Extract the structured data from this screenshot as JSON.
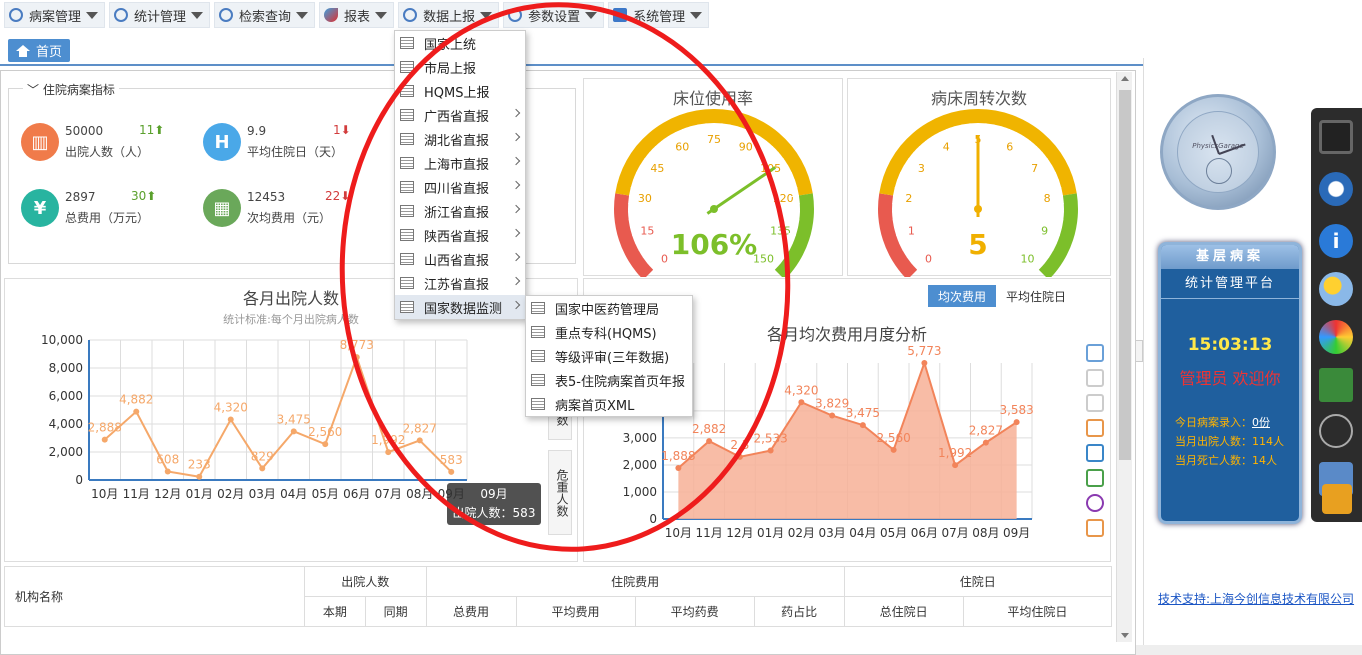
{
  "menu": [
    {
      "label": "病案管理",
      "icon": "record-icon"
    },
    {
      "label": "统计管理",
      "icon": "stats-icon"
    },
    {
      "label": "检索查询",
      "icon": "search-icon"
    },
    {
      "label": "报表",
      "icon": "report-icon"
    },
    {
      "label": "数据上报",
      "icon": "upload-icon"
    },
    {
      "label": "参数设置",
      "icon": "settings-icon"
    },
    {
      "label": "系统管理",
      "icon": "system-icon"
    }
  ],
  "tabs": {
    "home": "首页"
  },
  "indicators": {
    "legend": "住院病案指标",
    "items": [
      {
        "value": "50000",
        "label": "出院人数（人）",
        "delta": "11",
        "dir": "up",
        "color": "#f07b4a",
        "glyph": "▥"
      },
      {
        "value": "9.9",
        "label": "平均住院日（天）",
        "delta": "1",
        "dir": "down",
        "color": "#4aa8e8",
        "glyph": "H"
      },
      {
        "value": "2897",
        "label": "总费用（万元）",
        "delta": "30",
        "dir": "up",
        "color": "#28b4a0",
        "glyph": "¥"
      },
      {
        "value": "12453",
        "label": "次均费用（元）",
        "delta": "22",
        "dir": "down",
        "color": "#6aa85a",
        "glyph": "▦"
      }
    ]
  },
  "gauges": [
    {
      "title": "床位使用率",
      "value": "106%",
      "value_color": "#7cbf2a",
      "ticks": [
        "0",
        "15",
        "30",
        "45",
        "60",
        "75",
        "90",
        "105",
        "120",
        "135",
        "150"
      ],
      "min": 0,
      "max": 150,
      "reading": 106,
      "needle_color": "#7cbf2a"
    },
    {
      "title": "病床周转次数",
      "value": "5",
      "value_color": "#f0b000",
      "ticks": [
        "0",
        "1",
        "2",
        "3",
        "4",
        "5",
        "6",
        "7",
        "8",
        "9",
        "10"
      ],
      "min": 0,
      "max": 10,
      "reading": 5,
      "needle_color": "#f0b000"
    }
  ],
  "chart_data": [
    {
      "type": "line",
      "title": "各月出院人数",
      "subtitle": "统计标准:每个月出院病人数",
      "categories": [
        "10月",
        "11月",
        "12月",
        "01月",
        "02月",
        "03月",
        "04月",
        "05月",
        "06月",
        "07月",
        "08月",
        "09月"
      ],
      "values": [
        2888,
        4882,
        608,
        233,
        4320,
        829,
        3475,
        2560,
        8773,
        1992,
        2827,
        583
      ],
      "value_labels": [
        "2,888",
        "4,882",
        "608",
        "233",
        "4,320",
        "829",
        "3,475",
        "2,560",
        "8,773",
        "1,992",
        "2,827",
        "583"
      ],
      "yticks": [
        "10,000",
        "8,000",
        "6,000",
        "4,000",
        "2,000",
        "0"
      ],
      "ylim": [
        0,
        10000
      ],
      "color": "#f5a86a"
    },
    {
      "type": "area",
      "title": "各月均次费用月度分析",
      "categories": [
        "10月",
        "11月",
        "12月",
        "01月",
        "02月",
        "03月",
        "04月",
        "05月",
        "06月",
        "07月",
        "08月",
        "09月"
      ],
      "values": [
        1888,
        2882,
        2300,
        2533,
        4320,
        3829,
        3475,
        2560,
        5773,
        1992,
        2827,
        3583
      ],
      "value_labels": [
        "1,888",
        "2,882",
        "2,3",
        "2,533",
        "4,320",
        "3,829",
        "3,475",
        "2,560",
        "5,773",
        "1,992",
        "2,827",
        "3,583"
      ],
      "yticks": [
        "4,000",
        "3,000",
        "2,000",
        "1,000",
        "0"
      ],
      "ylim": [
        0,
        5773
      ],
      "color": "#f2845a"
    }
  ],
  "tooltip": {
    "title": "09月",
    "text": "出院人数：583"
  },
  "side_tabs": [
    "数",
    "危重人数"
  ],
  "toggle": {
    "active": "均次费用",
    "inactive": "平均住院日"
  },
  "table": {
    "org": "机构名称",
    "groups": [
      "出院人数",
      "住院费用",
      "住院日"
    ],
    "cols": [
      "本期",
      "同期",
      "总费用",
      "平均费用",
      "平均药费",
      "药占比",
      "总住院日",
      "平均住院日"
    ]
  },
  "right": {
    "card_title": "基层病案",
    "card_subtitle": "统计管理平台",
    "time": "15:03:13",
    "welcome": "管理员 欢迎你",
    "today_label": "今日病案录入：",
    "today_value": "0份",
    "month_discharge": "当月出院人数：114人",
    "month_death": "当月死亡人数：14人",
    "support": "技术支持:上海今创信息技术有限公司",
    "clock_brand": "PhysicsGarage"
  },
  "dropdown": {
    "items": [
      "国家上统",
      "市局上报",
      "HQMS上报",
      "广西省直报",
      "湖北省直报",
      "上海市直报",
      "四川省直报",
      "浙江省直报",
      "陕西省直报",
      "山西省直报",
      "江苏省直报",
      "国家数据监测"
    ],
    "has_sub": [
      false,
      false,
      false,
      true,
      true,
      true,
      true,
      true,
      true,
      true,
      true,
      true
    ],
    "sub": [
      "国家中医药管理局",
      "重点专科(HQMS)",
      "等级评审(三年数据)",
      "表5-住院病案首页年报",
      "病案首页XML"
    ]
  }
}
